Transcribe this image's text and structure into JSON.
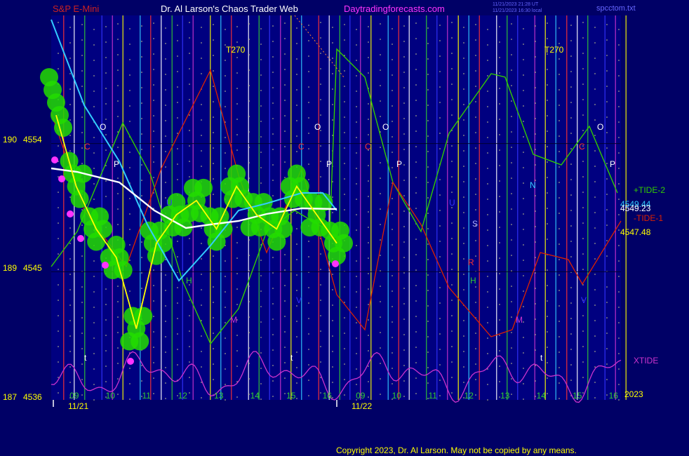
{
  "header": {
    "instrument": "S&P E-Mini",
    "site": "Dr. Al Larson's Chaos Trader Web",
    "url": "Daytradingforecasts.com",
    "stamp1": "11/21/2023 21:28 UT",
    "stamp2": "11/21/2023 16:30 local",
    "file": "spcctom.txt"
  },
  "copyright": "Copyright 2023, Dr. Al Larson. May not be copied by any means.",
  "colors": {
    "background": "#000066",
    "plot_bg": "#000080",
    "price": "#ffff00",
    "price_bubbles": "#22dd00",
    "ma_fast": "#33ccff",
    "ma_slow": "#ffffff",
    "tide_plus": "#33cc00",
    "tide_minus": "#dd2200",
    "xtide": "#cc33cc"
  },
  "chart_data": {
    "type": "line",
    "title": "S&P E-Mini",
    "y_axis_labels": [
      {
        "left": "190",
        "price": "4554"
      },
      {
        "left": "189",
        "price": "4545"
      },
      {
        "left": "187",
        "price": "4536"
      }
    ],
    "ylim": [
      4536,
      4563
    ],
    "x_hour_labels": [
      "09",
      "10",
      "11",
      "12",
      "13",
      "14",
      "15",
      "16",
      "09",
      "10",
      "11",
      "12",
      "13",
      "14",
      "15",
      "16"
    ],
    "x_date_labels": [
      "11/21",
      "11/22"
    ],
    "year_label": "2023",
    "series": [
      {
        "name": "+TIDE-2",
        "value_label": "4549.44"
      },
      {
        "name": "-TIDE-1",
        "value_label": "4547.48"
      },
      {
        "name": "XTIDE"
      }
    ],
    "moving_average_value": "4549.23",
    "price_series_hourly": [
      4556,
      4551,
      4548,
      4546,
      4541,
      4547,
      4549,
      4550,
      4548,
      4551,
      4549,
      4548,
      4551,
      4549,
      4547
    ],
    "markers": [
      {
        "label": "T270",
        "day": 1
      },
      {
        "label": "T270",
        "day": 2
      },
      {
        "label": "O"
      },
      {
        "label": "O"
      },
      {
        "label": "O"
      },
      {
        "label": "O"
      },
      {
        "label": "P"
      },
      {
        "label": "P"
      },
      {
        "label": "P"
      },
      {
        "label": "P"
      },
      {
        "label": "C"
      },
      {
        "label": "C"
      },
      {
        "label": "C"
      },
      {
        "label": "C"
      },
      {
        "label": "U"
      },
      {
        "label": "U"
      },
      {
        "label": "H"
      },
      {
        "label": "H"
      },
      {
        "label": "M"
      },
      {
        "label": "M"
      },
      {
        "label": "N"
      },
      {
        "label": "S"
      },
      {
        "label": "R"
      },
      {
        "label": "V"
      },
      {
        "label": "V"
      },
      {
        "label": "t"
      },
      {
        "label": "t"
      },
      {
        "label": "t"
      }
    ]
  }
}
